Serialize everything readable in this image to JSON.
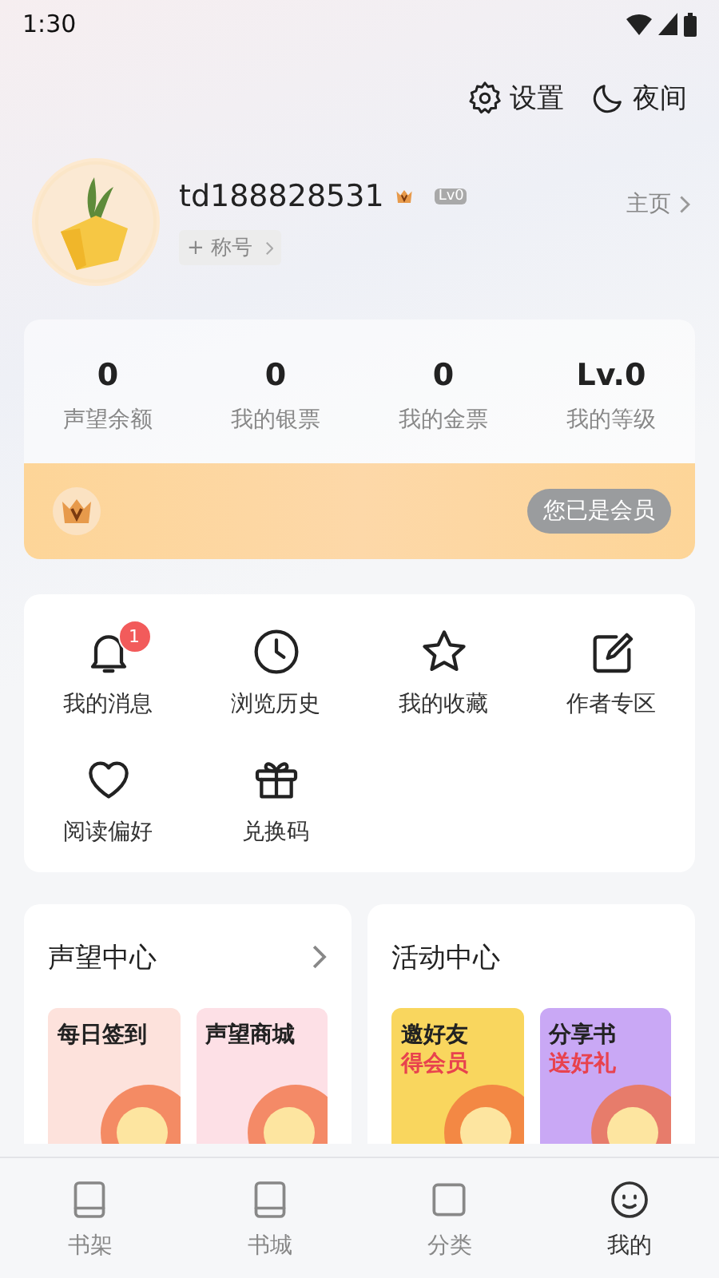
{
  "status_bar": {
    "time": "1:30"
  },
  "top_actions": [
    {
      "kind": "gear",
      "label": "设置"
    },
    {
      "kind": "moon",
      "label": "夜间"
    }
  ],
  "profile": {
    "username": "td188828531",
    "level_badge": "Lv0",
    "title_button": "+ 称号",
    "home_link": "主页"
  },
  "stats": [
    {
      "value": "0",
      "label": "声望余额"
    },
    {
      "value": "0",
      "label": "我的银票"
    },
    {
      "value": "0",
      "label": "我的金票"
    },
    {
      "value": "Lv.0",
      "label": "我的等级"
    }
  ],
  "vip": {
    "status": "您已是会员"
  },
  "shortcuts": [
    {
      "kind": "bell",
      "label": "我的消息",
      "badge": "1"
    },
    {
      "kind": "clock",
      "label": "浏览历史"
    },
    {
      "kind": "star",
      "label": "我的收藏"
    },
    {
      "kind": "edit",
      "label": "作者专区"
    },
    {
      "kind": "heart",
      "label": "阅读偏好"
    },
    {
      "kind": "gift",
      "label": "兑换码"
    }
  ],
  "panels": [
    {
      "title": "声望中心",
      "has_arrow": true,
      "tiles": [
        {
          "lines": [
            "每日签到"
          ],
          "color": "#fde2dc"
        },
        {
          "lines": [
            "声望商城"
          ],
          "color": "#fde0e6"
        }
      ]
    },
    {
      "title": "活动中心",
      "has_arrow": false,
      "tiles": [
        {
          "lines": [
            "邀好友",
            "得会员"
          ],
          "color": "#f9d65e"
        },
        {
          "lines": [
            "分享书",
            "送好礼"
          ],
          "color": "#c9a8f5"
        }
      ]
    }
  ],
  "tab_bar": [
    {
      "kind": "book",
      "label": "书架",
      "selected": false
    },
    {
      "kind": "book",
      "label": "书城",
      "selected": false
    },
    {
      "kind": "square",
      "label": "分类",
      "selected": false
    },
    {
      "kind": "face",
      "label": "我的",
      "selected": true
    }
  ]
}
